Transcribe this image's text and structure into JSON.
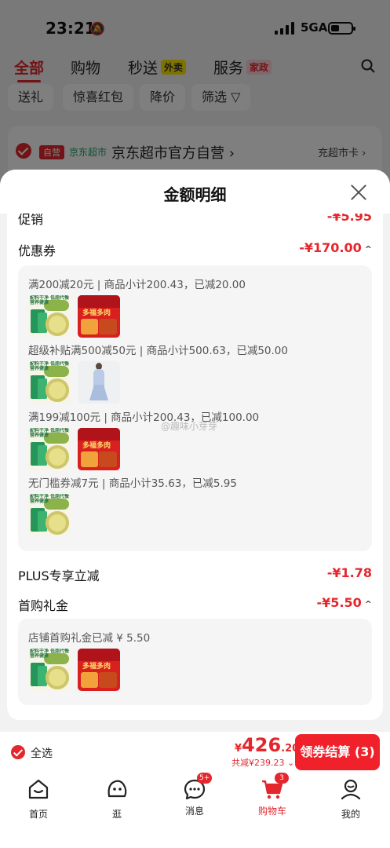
{
  "status_bar": {
    "time": "23:21",
    "network": "5GA"
  },
  "top_tabs": [
    {
      "label": "全部",
      "active": true
    },
    {
      "label": "购物",
      "active": false
    },
    {
      "label": "秒送",
      "tag": "外卖",
      "active": false
    },
    {
      "label": "服务",
      "tag": "家政",
      "active": false
    }
  ],
  "filters": [
    "送礼",
    "惊喜红包",
    "降价",
    "筛选"
  ],
  "store": {
    "badge": "自营",
    "sub": "京东超市",
    "name": "京东超市官方自营",
    "chevron": "›",
    "right_link": "充超市卡 ›"
  },
  "sheet": {
    "title": "金额明细",
    "promo": {
      "label": "促销",
      "value": "-¥5.95"
    },
    "coupon": {
      "label": "优惠券",
      "value": "-¥170.00",
      "caret": "^"
    },
    "coupon_lines": [
      "满200减20元 | 商品小计200.43，已减20.00",
      "超级补贴满500减50元 | 商品小计500.63，已减50.00",
      "满199减100元 | 商品小计200.43，已减100.00",
      "无门槛券减7元 | 商品小计35.63，已减5.95"
    ],
    "plus": {
      "label": "PLUS专享立减",
      "value": "-¥1.78"
    },
    "first_gift": {
      "label": "首购礼金",
      "value": "-¥5.50",
      "caret": "^"
    },
    "first_gift_line": "店铺首购礼金已减 ¥ 5.50",
    "thumb_text": {
      "powder": "配料干净\n低脂代餐\n营养健康",
      "meat": "多福多肉"
    },
    "watermark": "@趣味小芽芽"
  },
  "checkout": {
    "select_all": "全选",
    "currency": "¥",
    "price_int": "426",
    "price_dec": ".20",
    "saved": "共减¥239.23",
    "saved_caret": "⌄",
    "button": "领券结算 (3)"
  },
  "nav": [
    {
      "label": "首页",
      "icon": "home-icon"
    },
    {
      "label": "逛",
      "icon": "explore-icon"
    },
    {
      "label": "消息",
      "icon": "message-icon",
      "badge": "5+"
    },
    {
      "label": "购物车",
      "icon": "cart-icon",
      "badge": "3",
      "active": true
    },
    {
      "label": "我的",
      "icon": "profile-icon"
    }
  ],
  "colors": {
    "accent": "#e4262d",
    "jd_green": "#1aa064"
  }
}
